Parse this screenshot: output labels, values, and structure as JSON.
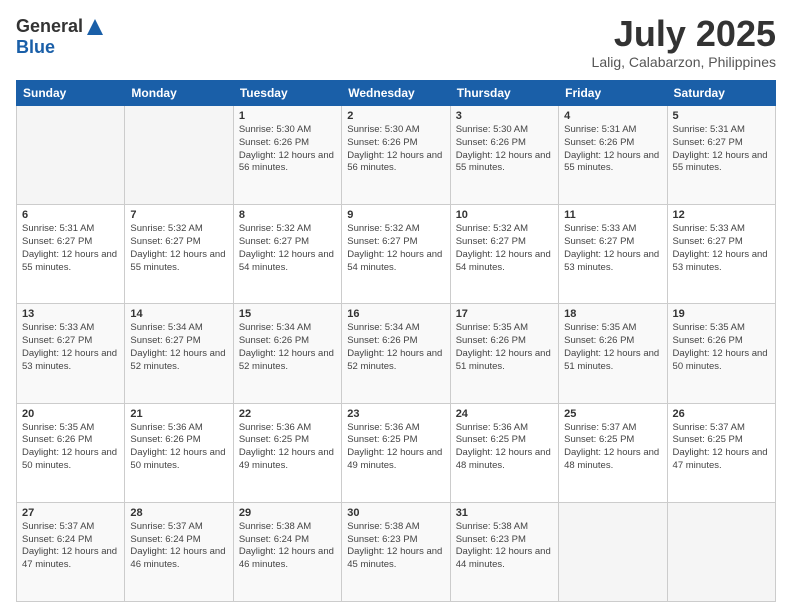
{
  "header": {
    "logo_general": "General",
    "logo_blue": "Blue",
    "month_title": "July 2025",
    "location": "Lalig, Calabarzon, Philippines"
  },
  "days_of_week": [
    "Sunday",
    "Monday",
    "Tuesday",
    "Wednesday",
    "Thursday",
    "Friday",
    "Saturday"
  ],
  "weeks": [
    [
      {
        "day": "",
        "sunrise": "",
        "sunset": "",
        "daylight": ""
      },
      {
        "day": "",
        "sunrise": "",
        "sunset": "",
        "daylight": ""
      },
      {
        "day": "1",
        "sunrise": "Sunrise: 5:30 AM",
        "sunset": "Sunset: 6:26 PM",
        "daylight": "Daylight: 12 hours and 56 minutes."
      },
      {
        "day": "2",
        "sunrise": "Sunrise: 5:30 AM",
        "sunset": "Sunset: 6:26 PM",
        "daylight": "Daylight: 12 hours and 56 minutes."
      },
      {
        "day": "3",
        "sunrise": "Sunrise: 5:30 AM",
        "sunset": "Sunset: 6:26 PM",
        "daylight": "Daylight: 12 hours and 55 minutes."
      },
      {
        "day": "4",
        "sunrise": "Sunrise: 5:31 AM",
        "sunset": "Sunset: 6:26 PM",
        "daylight": "Daylight: 12 hours and 55 minutes."
      },
      {
        "day": "5",
        "sunrise": "Sunrise: 5:31 AM",
        "sunset": "Sunset: 6:27 PM",
        "daylight": "Daylight: 12 hours and 55 minutes."
      }
    ],
    [
      {
        "day": "6",
        "sunrise": "Sunrise: 5:31 AM",
        "sunset": "Sunset: 6:27 PM",
        "daylight": "Daylight: 12 hours and 55 minutes."
      },
      {
        "day": "7",
        "sunrise": "Sunrise: 5:32 AM",
        "sunset": "Sunset: 6:27 PM",
        "daylight": "Daylight: 12 hours and 55 minutes."
      },
      {
        "day": "8",
        "sunrise": "Sunrise: 5:32 AM",
        "sunset": "Sunset: 6:27 PM",
        "daylight": "Daylight: 12 hours and 54 minutes."
      },
      {
        "day": "9",
        "sunrise": "Sunrise: 5:32 AM",
        "sunset": "Sunset: 6:27 PM",
        "daylight": "Daylight: 12 hours and 54 minutes."
      },
      {
        "day": "10",
        "sunrise": "Sunrise: 5:32 AM",
        "sunset": "Sunset: 6:27 PM",
        "daylight": "Daylight: 12 hours and 54 minutes."
      },
      {
        "day": "11",
        "sunrise": "Sunrise: 5:33 AM",
        "sunset": "Sunset: 6:27 PM",
        "daylight": "Daylight: 12 hours and 53 minutes."
      },
      {
        "day": "12",
        "sunrise": "Sunrise: 5:33 AM",
        "sunset": "Sunset: 6:27 PM",
        "daylight": "Daylight: 12 hours and 53 minutes."
      }
    ],
    [
      {
        "day": "13",
        "sunrise": "Sunrise: 5:33 AM",
        "sunset": "Sunset: 6:27 PM",
        "daylight": "Daylight: 12 hours and 53 minutes."
      },
      {
        "day": "14",
        "sunrise": "Sunrise: 5:34 AM",
        "sunset": "Sunset: 6:27 PM",
        "daylight": "Daylight: 12 hours and 52 minutes."
      },
      {
        "day": "15",
        "sunrise": "Sunrise: 5:34 AM",
        "sunset": "Sunset: 6:26 PM",
        "daylight": "Daylight: 12 hours and 52 minutes."
      },
      {
        "day": "16",
        "sunrise": "Sunrise: 5:34 AM",
        "sunset": "Sunset: 6:26 PM",
        "daylight": "Daylight: 12 hours and 52 minutes."
      },
      {
        "day": "17",
        "sunrise": "Sunrise: 5:35 AM",
        "sunset": "Sunset: 6:26 PM",
        "daylight": "Daylight: 12 hours and 51 minutes."
      },
      {
        "day": "18",
        "sunrise": "Sunrise: 5:35 AM",
        "sunset": "Sunset: 6:26 PM",
        "daylight": "Daylight: 12 hours and 51 minutes."
      },
      {
        "day": "19",
        "sunrise": "Sunrise: 5:35 AM",
        "sunset": "Sunset: 6:26 PM",
        "daylight": "Daylight: 12 hours and 50 minutes."
      }
    ],
    [
      {
        "day": "20",
        "sunrise": "Sunrise: 5:35 AM",
        "sunset": "Sunset: 6:26 PM",
        "daylight": "Daylight: 12 hours and 50 minutes."
      },
      {
        "day": "21",
        "sunrise": "Sunrise: 5:36 AM",
        "sunset": "Sunset: 6:26 PM",
        "daylight": "Daylight: 12 hours and 50 minutes."
      },
      {
        "day": "22",
        "sunrise": "Sunrise: 5:36 AM",
        "sunset": "Sunset: 6:25 PM",
        "daylight": "Daylight: 12 hours and 49 minutes."
      },
      {
        "day": "23",
        "sunrise": "Sunrise: 5:36 AM",
        "sunset": "Sunset: 6:25 PM",
        "daylight": "Daylight: 12 hours and 49 minutes."
      },
      {
        "day": "24",
        "sunrise": "Sunrise: 5:36 AM",
        "sunset": "Sunset: 6:25 PM",
        "daylight": "Daylight: 12 hours and 48 minutes."
      },
      {
        "day": "25",
        "sunrise": "Sunrise: 5:37 AM",
        "sunset": "Sunset: 6:25 PM",
        "daylight": "Daylight: 12 hours and 48 minutes."
      },
      {
        "day": "26",
        "sunrise": "Sunrise: 5:37 AM",
        "sunset": "Sunset: 6:25 PM",
        "daylight": "Daylight: 12 hours and 47 minutes."
      }
    ],
    [
      {
        "day": "27",
        "sunrise": "Sunrise: 5:37 AM",
        "sunset": "Sunset: 6:24 PM",
        "daylight": "Daylight: 12 hours and 47 minutes."
      },
      {
        "day": "28",
        "sunrise": "Sunrise: 5:37 AM",
        "sunset": "Sunset: 6:24 PM",
        "daylight": "Daylight: 12 hours and 46 minutes."
      },
      {
        "day": "29",
        "sunrise": "Sunrise: 5:38 AM",
        "sunset": "Sunset: 6:24 PM",
        "daylight": "Daylight: 12 hours and 46 minutes."
      },
      {
        "day": "30",
        "sunrise": "Sunrise: 5:38 AM",
        "sunset": "Sunset: 6:23 PM",
        "daylight": "Daylight: 12 hours and 45 minutes."
      },
      {
        "day": "31",
        "sunrise": "Sunrise: 5:38 AM",
        "sunset": "Sunset: 6:23 PM",
        "daylight": "Daylight: 12 hours and 44 minutes."
      },
      {
        "day": "",
        "sunrise": "",
        "sunset": "",
        "daylight": ""
      },
      {
        "day": "",
        "sunrise": "",
        "sunset": "",
        "daylight": ""
      }
    ]
  ]
}
